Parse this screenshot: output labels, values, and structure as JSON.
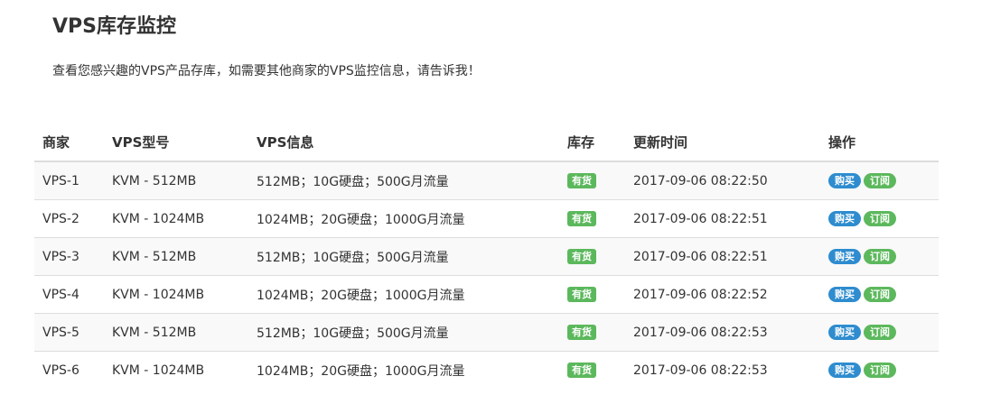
{
  "header": {
    "title": "VPS库存监控",
    "intro": "查看您感兴趣的VPS产品存库，如需要其他商家的VPS监控信息，请告诉我！"
  },
  "table": {
    "columns": [
      "商家",
      "VPS型号",
      "VPS信息",
      "库存",
      "更新时间",
      "操作"
    ],
    "rows": [
      {
        "vendor": "VPS-1",
        "model": "KVM - 512MB",
        "info": "512MB；10G硬盘；500G月流量",
        "stock": "有货",
        "updated": "2017-09-06 08:22:50",
        "buy": "购买",
        "subscribe": "订阅"
      },
      {
        "vendor": "VPS-2",
        "model": "KVM - 1024MB",
        "info": "1024MB；20G硬盘；1000G月流量",
        "stock": "有货",
        "updated": "2017-09-06 08:22:51",
        "buy": "购买",
        "subscribe": "订阅"
      },
      {
        "vendor": "VPS-3",
        "model": "KVM - 512MB",
        "info": "512MB；10G硬盘；500G月流量",
        "stock": "有货",
        "updated": "2017-09-06 08:22:51",
        "buy": "购买",
        "subscribe": "订阅"
      },
      {
        "vendor": "VPS-4",
        "model": "KVM - 1024MB",
        "info": "1024MB；20G硬盘；1000G月流量",
        "stock": "有货",
        "updated": "2017-09-06 08:22:52",
        "buy": "购买",
        "subscribe": "订阅"
      },
      {
        "vendor": "VPS-5",
        "model": "KVM - 512MB",
        "info": "512MB；10G硬盘；500G月流量",
        "stock": "有货",
        "updated": "2017-09-06 08:22:53",
        "buy": "购买",
        "subscribe": "订阅"
      },
      {
        "vendor": "VPS-6",
        "model": "KVM - 1024MB",
        "info": "1024MB；20G硬盘；1000G月流量",
        "stock": "有货",
        "updated": "2017-09-06 08:22:53",
        "buy": "购买",
        "subscribe": "订阅"
      }
    ]
  },
  "colors": {
    "in_stock": "#5cb85c",
    "buy": "#2e8ccf",
    "subscribe": "#5cb85c"
  }
}
